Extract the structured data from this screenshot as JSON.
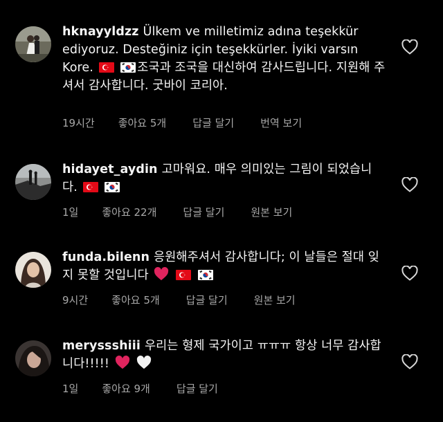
{
  "comments": [
    {
      "username": "hknayyldzz",
      "text_parts": [
        "Ülkem ve milletimiz adına teşekkür ediyoruz. Desteğiniz için teşekkürler. İyiki varsın Kore.",
        "조국과 조국을 대신하여 감사드립니다. 지원해 주셔서 감사합니다. 굿바이 코리아."
      ],
      "time": "19시간",
      "likes": "좋아요 5개",
      "reply": "답글 달기",
      "translate": "번역 보기"
    },
    {
      "username": "hidayet_aydin",
      "text_parts": [
        "고마워요. 매우 의미있는 그림이 되었습니다.",
        ""
      ],
      "time": "1일",
      "likes": "좋아요 22개",
      "reply": "답글 달기",
      "translate": "원본 보기"
    },
    {
      "username": "funda.bilenn",
      "text_parts": [
        "응원해주셔서 감사합니다; 이 날들은 절대 잊지 못할 것입니다",
        ""
      ],
      "time": "9시간",
      "likes": "좋아요 5개",
      "reply": "답글 달기",
      "translate": "원본 보기"
    },
    {
      "username": "meryssshiii",
      "text_parts": [
        "우리는 형제 국가이고 ㅠㅠㅠ 항상 너무 감사합니다!!!!!",
        ""
      ],
      "time": "1일",
      "likes": "좋아요 9개",
      "reply": "답글 달기"
    }
  ],
  "colors": {
    "background": "#000000",
    "text": "#f5f5f5",
    "meta": "#a8a8a8",
    "turkey_red": "#e30a17",
    "heart_red": "#e0245e"
  },
  "icons": [
    "heart-outline-icon",
    "turkey-flag-emoji",
    "korea-flag-emoji",
    "red-heart-emoji",
    "white-heart-emoji"
  ]
}
